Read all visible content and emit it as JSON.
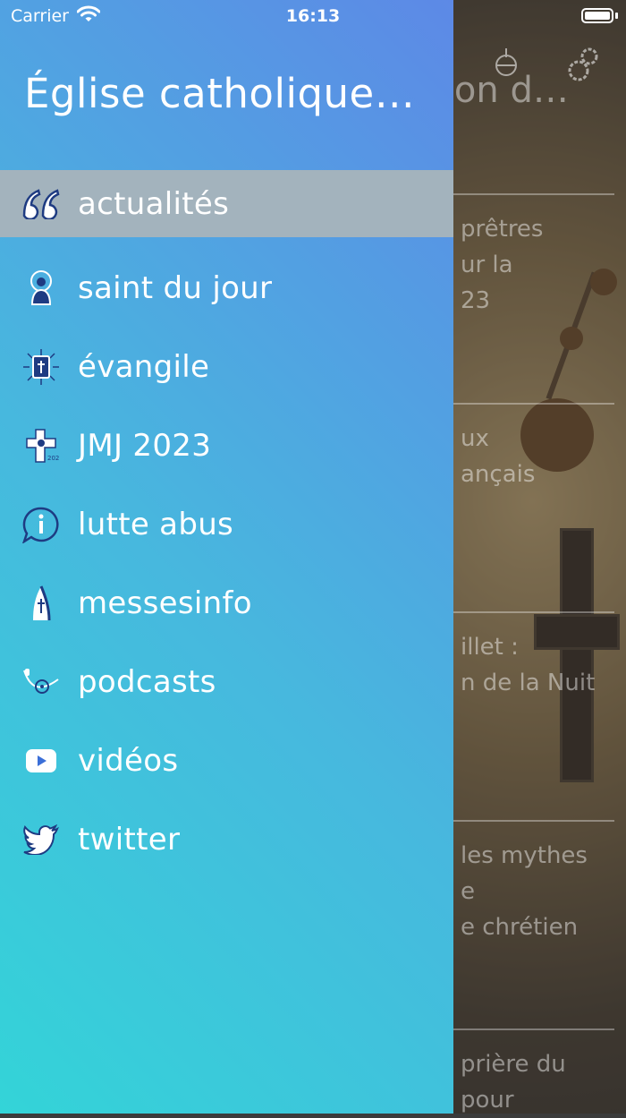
{
  "status_bar": {
    "carrier": "Carrier",
    "time": "16:13"
  },
  "drawer": {
    "title": "Église catholique…",
    "items": [
      {
        "label": "actualités",
        "icon": "quote-icon",
        "active": true
      },
      {
        "label": "saint du jour",
        "icon": "saint-icon"
      },
      {
        "label": "évangile",
        "icon": "bible-icon"
      },
      {
        "label": "JMJ 2023",
        "icon": "jmj-icon"
      },
      {
        "label": "lutte abus",
        "icon": "info-bubble-icon"
      },
      {
        "label": "messesinfo",
        "icon": "church-icon"
      },
      {
        "label": "podcasts",
        "icon": "earphones-icon"
      },
      {
        "label": "vidéos",
        "icon": "play-icon"
      },
      {
        "label": "twitter",
        "icon": "twitter-icon"
      }
    ]
  },
  "background": {
    "title": "ition d…",
    "articles": [
      "prêtres\nur la\n23",
      "ux\nançais",
      "illet :\nn de la Nuit",
      "les mythes\ne\ne chrétien",
      "prière du\npour"
    ]
  }
}
